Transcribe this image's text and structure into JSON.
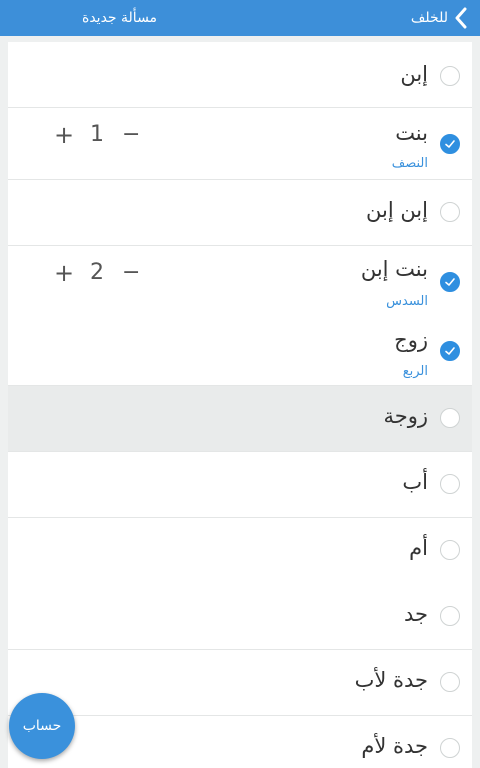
{
  "header": {
    "back_label": "للخلف",
    "title": "مسألة جديدة"
  },
  "colors": {
    "accent": "#3d8fd9",
    "checked": "#2f8fe0",
    "share": "#3a91dc"
  },
  "heirs": [
    {
      "name": "إبن",
      "checked": false
    },
    {
      "name": "بنت",
      "checked": true,
      "share": "النصف",
      "count": "1",
      "plus": "+",
      "minus": "−"
    },
    {
      "name": "إبن إبن",
      "checked": false
    },
    {
      "name": "بنت إبن",
      "checked": true,
      "share": "السدس",
      "count": "2",
      "plus": "+",
      "minus": "−"
    },
    {
      "name": "زوج",
      "checked": true,
      "share": "الربع"
    },
    {
      "name": "زوجة",
      "checked": false
    },
    {
      "name": "أب",
      "checked": false
    },
    {
      "name": "أم",
      "checked": false
    },
    {
      "name": "جد",
      "checked": false
    },
    {
      "name": "جدة لأب",
      "checked": false
    },
    {
      "name": "جدة لأم",
      "checked": false
    }
  ],
  "fab": {
    "label": "حساب"
  }
}
